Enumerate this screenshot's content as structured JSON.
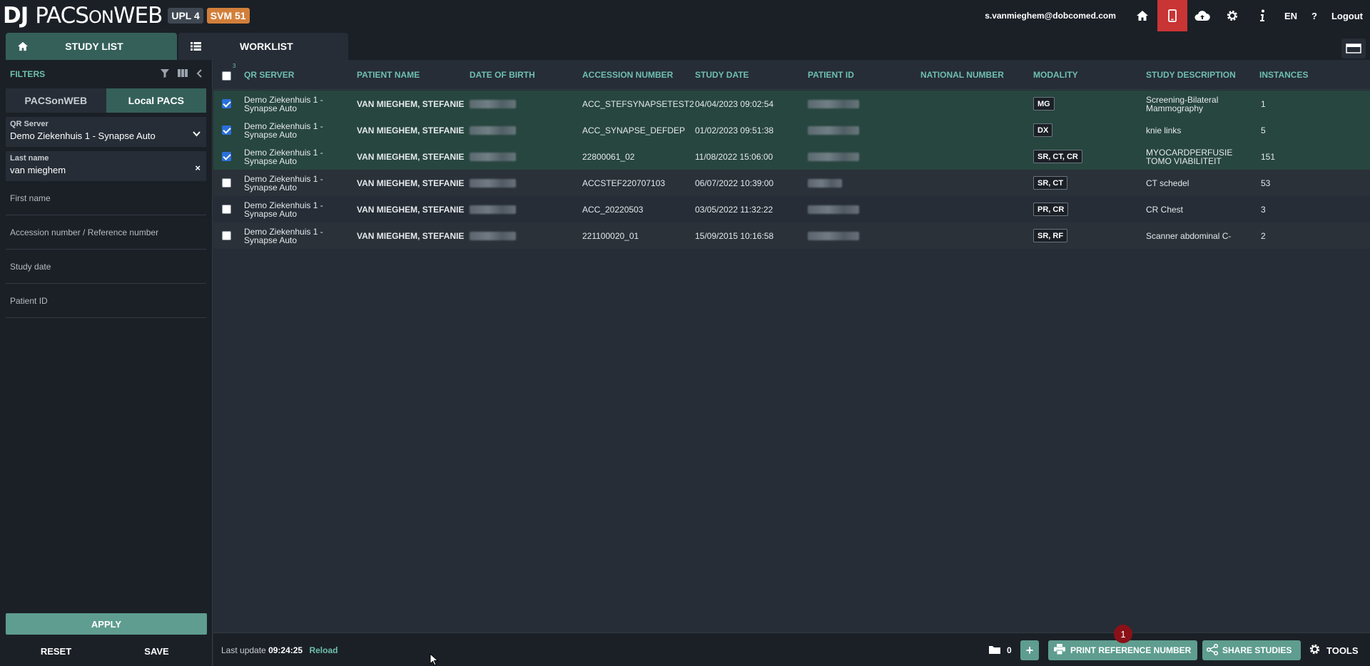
{
  "app": {
    "logo_dj": "DJ",
    "logo_pacs": "PACS",
    "logo_on": "ON",
    "logo_web": "WEB",
    "badge_upl": "UPL 4",
    "badge_svm": "SVM 51"
  },
  "header": {
    "user_email": "s.vanmieghem@dobcomed.com",
    "language": "EN",
    "help": "?",
    "logout": "Logout",
    "active_color": "#c93434"
  },
  "tabs": {
    "study_list": "STUDY LIST",
    "worklist": "WORKLIST"
  },
  "sidebar": {
    "filters_title": "FILTERS",
    "segment_pacsonweb": "PACSonWEB",
    "segment_local": "Local PACS",
    "qr_label": "QR Server",
    "qr_value": "Demo Ziekenhuis 1 - Synapse Auto",
    "lastname_label": "Last name",
    "lastname_value": "van mieghem",
    "clear": "×",
    "first_name": "First name",
    "accession": "Accession number / Reference number",
    "study_date": "Study date",
    "patient_id": "Patient ID",
    "apply": "APPLY",
    "reset": "RESET",
    "save": "SAVE"
  },
  "table": {
    "selected_count": "3",
    "columns": {
      "qr_server": "QR SERVER",
      "patient_name": "PATIENT NAME",
      "dob": "DATE OF BIRTH",
      "accession": "ACCESSION NUMBER",
      "study_date": "STUDY DATE",
      "patient_id": "PATIENT ID",
      "national": "NATIONAL NUMBER",
      "modality": "MODALITY",
      "description": "STUDY DESCRIPTION",
      "instances": "INSTANCES"
    },
    "rows": [
      {
        "qr": "Demo Ziekenhuis 1 - Synapse Auto",
        "name": "VAN MIEGHEM, STEFANIE",
        "accession": "ACC_STEFSYNAPSETEST2",
        "date": "04/04/2023 09:02:54",
        "modality": "MG",
        "description": "Screening-Bilateral Mammography",
        "instances": "1"
      },
      {
        "qr": "Demo Ziekenhuis 1 - Synapse Auto",
        "name": "VAN MIEGHEM, STEFANIE",
        "accession": "ACC_SYNAPSE_DEFDEP",
        "date": "01/02/2023 09:51:38",
        "modality": "DX",
        "description": "knie links",
        "instances": "5"
      },
      {
        "qr": "Demo Ziekenhuis 1 - Synapse Auto",
        "name": "VAN MIEGHEM, STEFANIE",
        "accession": "22800061_02",
        "date": "11/08/2022 15:06:00",
        "modality": "SR, CT, CR",
        "description": "MYOCARDPERFUSIE TOMO VIABILITEIT",
        "instances": "151"
      },
      {
        "qr": "Demo Ziekenhuis 1 - Synapse Auto",
        "name": "VAN MIEGHEM, STEFANIE",
        "accession": "ACCSTEF220707103",
        "date": "06/07/2022 10:39:00",
        "modality": "SR, CT",
        "description": "CT schedel",
        "instances": "53"
      },
      {
        "qr": "Demo Ziekenhuis 1 - Synapse Auto",
        "name": "VAN MIEGHEM, STEFANIE",
        "accession": "ACC_20220503",
        "date": "03/05/2022 11:32:22",
        "modality": "PR, CR",
        "description": "CR Chest",
        "instances": "3"
      },
      {
        "qr": "Demo Ziekenhuis 1 - Synapse Auto",
        "name": "VAN MIEGHEM, STEFANIE",
        "accession": "221100020_01",
        "date": "15/09/2015 10:16:58",
        "modality": "SR, RF",
        "description": "Scanner abdominal C-",
        "instances": "2"
      }
    ]
  },
  "footer": {
    "last_update_label": "Last update",
    "last_update_time": "09:24:25",
    "reload": "Reload",
    "folder_count": "0",
    "plus": "+",
    "print": "PRINT REFERENCE NUMBER",
    "notification_count": "1",
    "share": "SHARE STUDIES",
    "tools": "TOOLS"
  }
}
